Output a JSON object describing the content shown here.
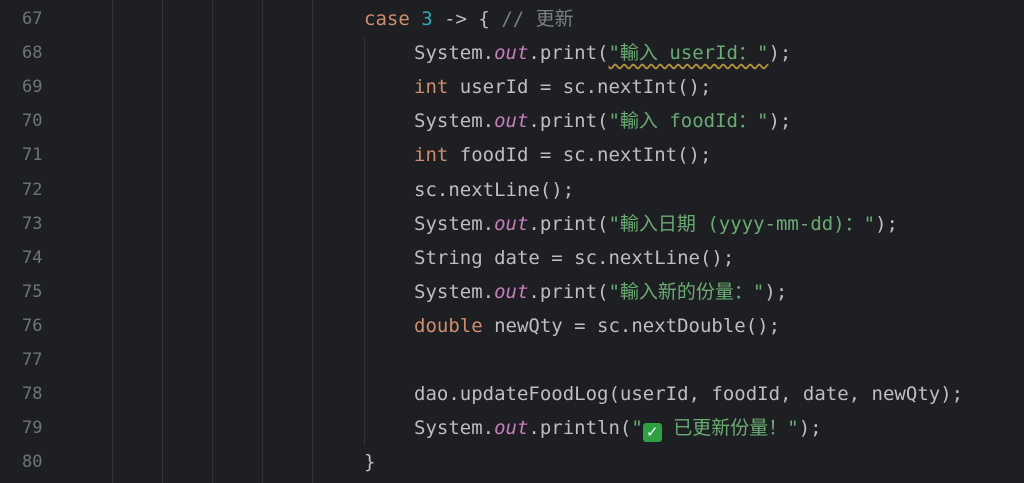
{
  "lines": [
    {
      "num": "67",
      "tokens": [
        {
          "t": "case",
          "c": "kw"
        },
        {
          "t": " ",
          "c": "plain"
        },
        {
          "t": "3",
          "c": "num"
        },
        {
          "t": " -> { ",
          "c": "plain"
        },
        {
          "t": "// 更新",
          "c": "cmt"
        }
      ]
    },
    {
      "num": "68",
      "tokens": [
        {
          "t": "System.",
          "c": "plain"
        },
        {
          "t": "out",
          "c": "field"
        },
        {
          "t": ".print(",
          "c": "plain"
        },
        {
          "t": "\"輸入 userId：\"",
          "c": "str warn"
        },
        {
          "t": ");",
          "c": "plain"
        }
      ]
    },
    {
      "num": "69",
      "tokens": [
        {
          "t": "int",
          "c": "kw"
        },
        {
          "t": " userId = sc.nextInt();",
          "c": "plain"
        }
      ]
    },
    {
      "num": "70",
      "tokens": [
        {
          "t": "System.",
          "c": "plain"
        },
        {
          "t": "out",
          "c": "field"
        },
        {
          "t": ".print(",
          "c": "plain"
        },
        {
          "t": "\"輸入 foodId：\"",
          "c": "str"
        },
        {
          "t": ");",
          "c": "plain"
        }
      ]
    },
    {
      "num": "71",
      "tokens": [
        {
          "t": "int",
          "c": "kw"
        },
        {
          "t": " foodId = sc.nextInt();",
          "c": "plain"
        }
      ]
    },
    {
      "num": "72",
      "tokens": [
        {
          "t": "sc.nextLine();",
          "c": "plain"
        }
      ]
    },
    {
      "num": "73",
      "tokens": [
        {
          "t": "System.",
          "c": "plain"
        },
        {
          "t": "out",
          "c": "field"
        },
        {
          "t": ".print(",
          "c": "plain"
        },
        {
          "t": "\"輸入日期 (yyyy-mm-dd)：\"",
          "c": "str"
        },
        {
          "t": ");",
          "c": "plain"
        }
      ]
    },
    {
      "num": "74",
      "tokens": [
        {
          "t": "String date = sc.nextLine();",
          "c": "plain"
        }
      ]
    },
    {
      "num": "75",
      "tokens": [
        {
          "t": "System.",
          "c": "plain"
        },
        {
          "t": "out",
          "c": "field"
        },
        {
          "t": ".print(",
          "c": "plain"
        },
        {
          "t": "\"輸入新的份量：\"",
          "c": "str"
        },
        {
          "t": ");",
          "c": "plain"
        }
      ]
    },
    {
      "num": "76",
      "tokens": [
        {
          "t": "double",
          "c": "kw"
        },
        {
          "t": " newQty = sc.nextDouble();",
          "c": "plain"
        }
      ]
    },
    {
      "num": "77",
      "tokens": []
    },
    {
      "num": "78",
      "tokens": [
        {
          "t": "dao.updateFoodLog(userId, foodId, date, newQty);",
          "c": "plain"
        }
      ]
    },
    {
      "num": "79",
      "tokens": [
        {
          "t": "System.",
          "c": "plain"
        },
        {
          "t": "out",
          "c": "field"
        },
        {
          "t": ".println(",
          "c": "plain"
        },
        {
          "t": "\"",
          "c": "str"
        },
        {
          "t": "✓",
          "c": "check"
        },
        {
          "t": " 已更新份量！\"",
          "c": "str"
        },
        {
          "t": ");",
          "c": "plain"
        }
      ]
    },
    {
      "num": "80",
      "tokens": [
        {
          "t": "}",
          "c": "plain"
        }
      ]
    }
  ],
  "indent_levels": [
    "0",
    "1",
    "1",
    "1",
    "1",
    "1",
    "1",
    "1",
    "1",
    "1",
    "1",
    "1",
    "1",
    "0"
  ]
}
